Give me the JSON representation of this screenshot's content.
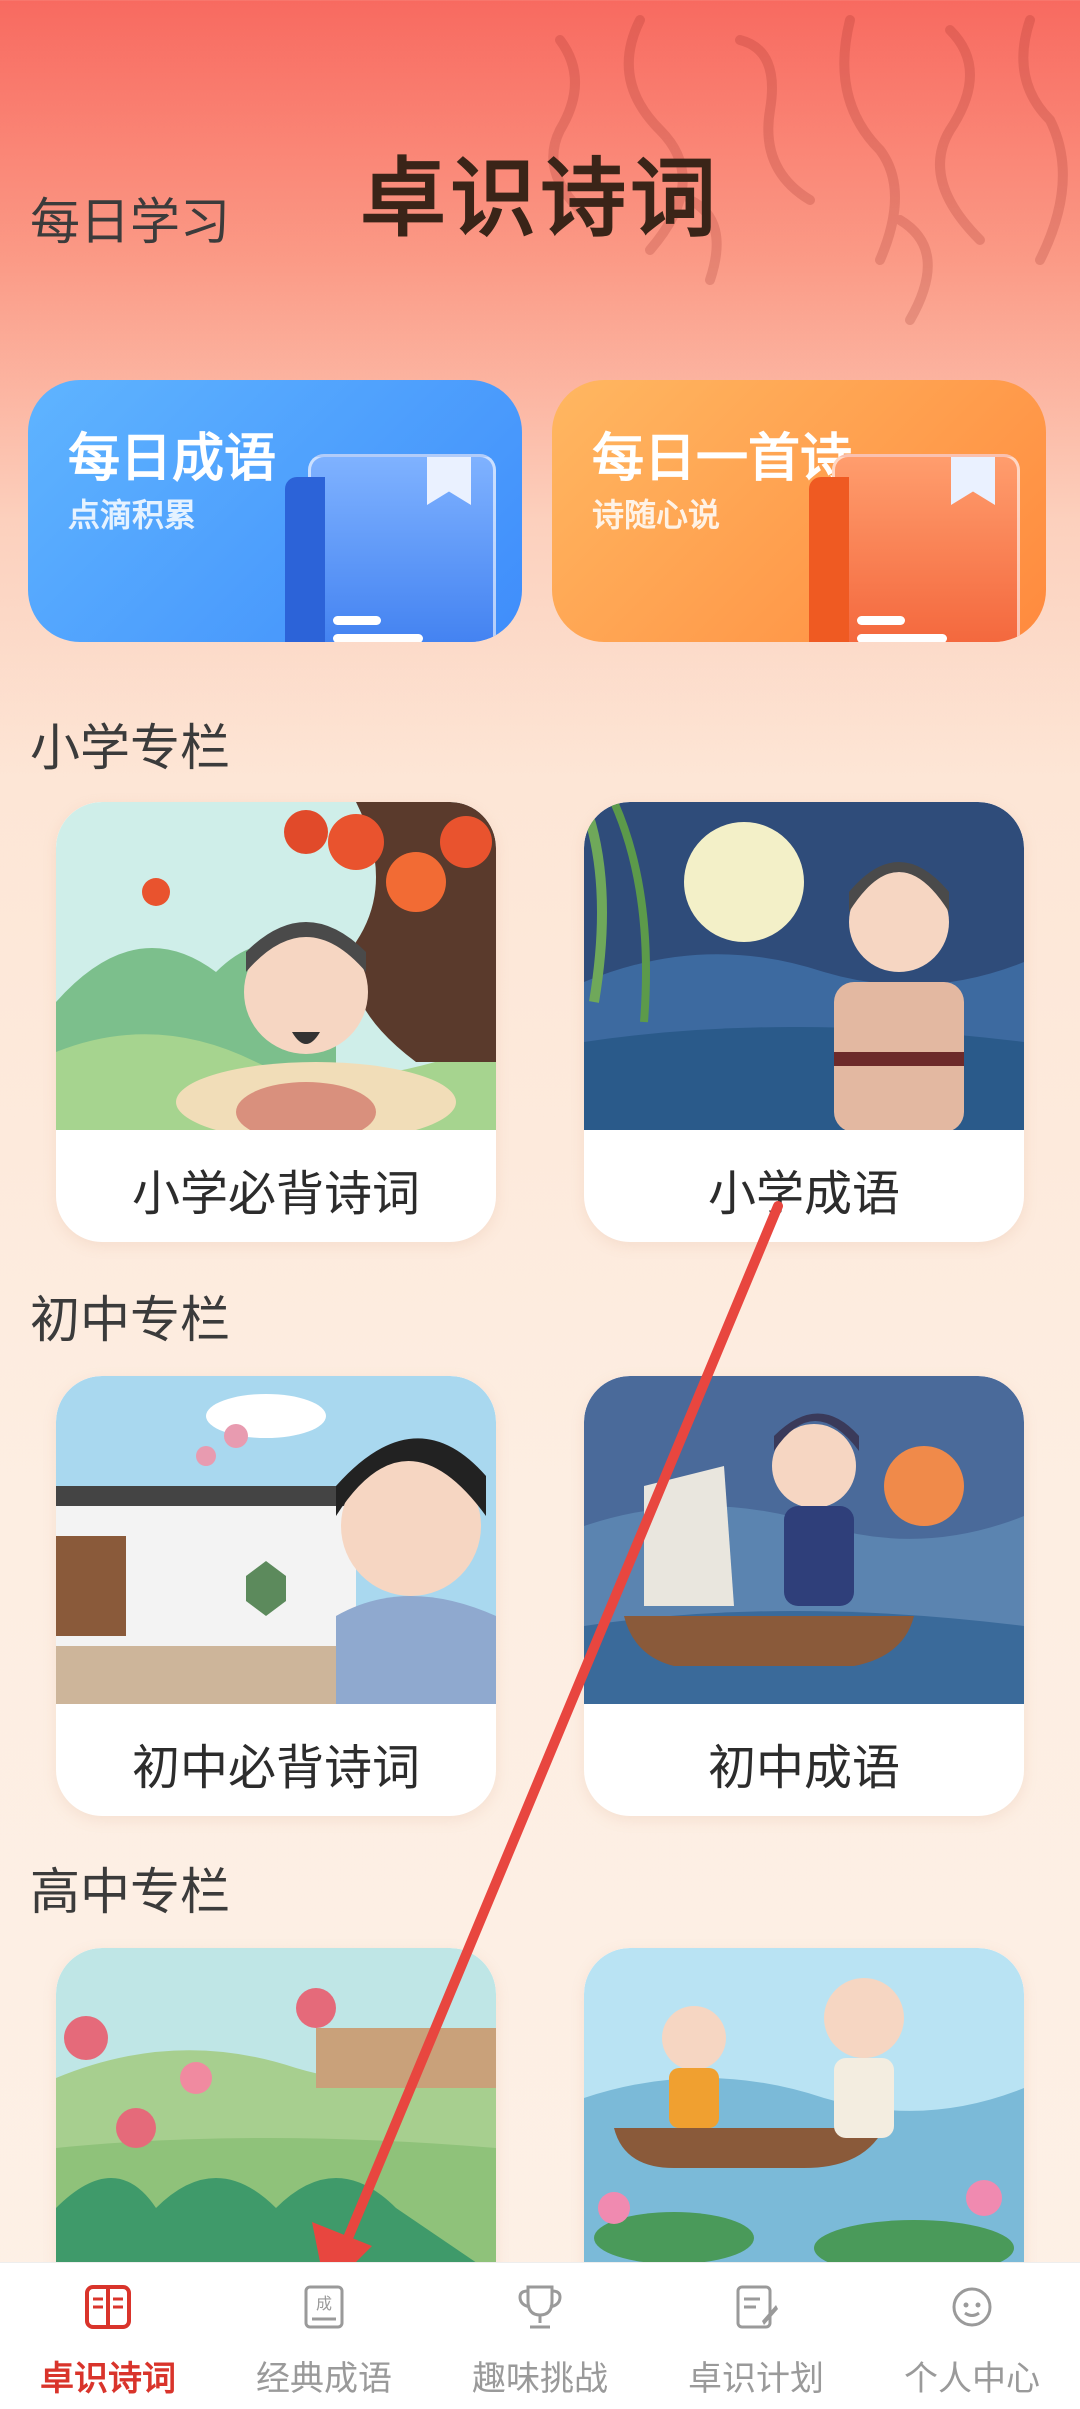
{
  "app_title": "卓识诗词",
  "daily_section": {
    "label": "每日学习",
    "cards": [
      {
        "title": "每日成语",
        "subtitle": "点滴积累"
      },
      {
        "title": "每日一首诗",
        "subtitle": "诗随心说"
      }
    ]
  },
  "primary_section": {
    "label": "小学专栏",
    "cards": [
      {
        "label": "小学必背诗词"
      },
      {
        "label": "小学成语"
      }
    ]
  },
  "junior_section": {
    "label": "初中专栏",
    "cards": [
      {
        "label": "初中必背诗词"
      },
      {
        "label": "初中成语"
      }
    ]
  },
  "senior_section": {
    "label": "高中专栏"
  },
  "tabbar": {
    "tabs": [
      {
        "label": "卓识诗词",
        "icon": "book-open-icon",
        "active": true
      },
      {
        "label": "经典成语",
        "icon": "idiom-book-icon",
        "active": false
      },
      {
        "label": "趣味挑战",
        "icon": "trophy-icon",
        "active": false
      },
      {
        "label": "卓识计划",
        "icon": "plan-edit-icon",
        "active": false
      },
      {
        "label": "个人中心",
        "icon": "profile-face-icon",
        "active": false
      }
    ]
  },
  "colors": {
    "accent_red": "#d9342b",
    "arrow_red": "#e8463f",
    "daily_blue": "#3f8dfb",
    "daily_orange": "#ff8a3e"
  }
}
